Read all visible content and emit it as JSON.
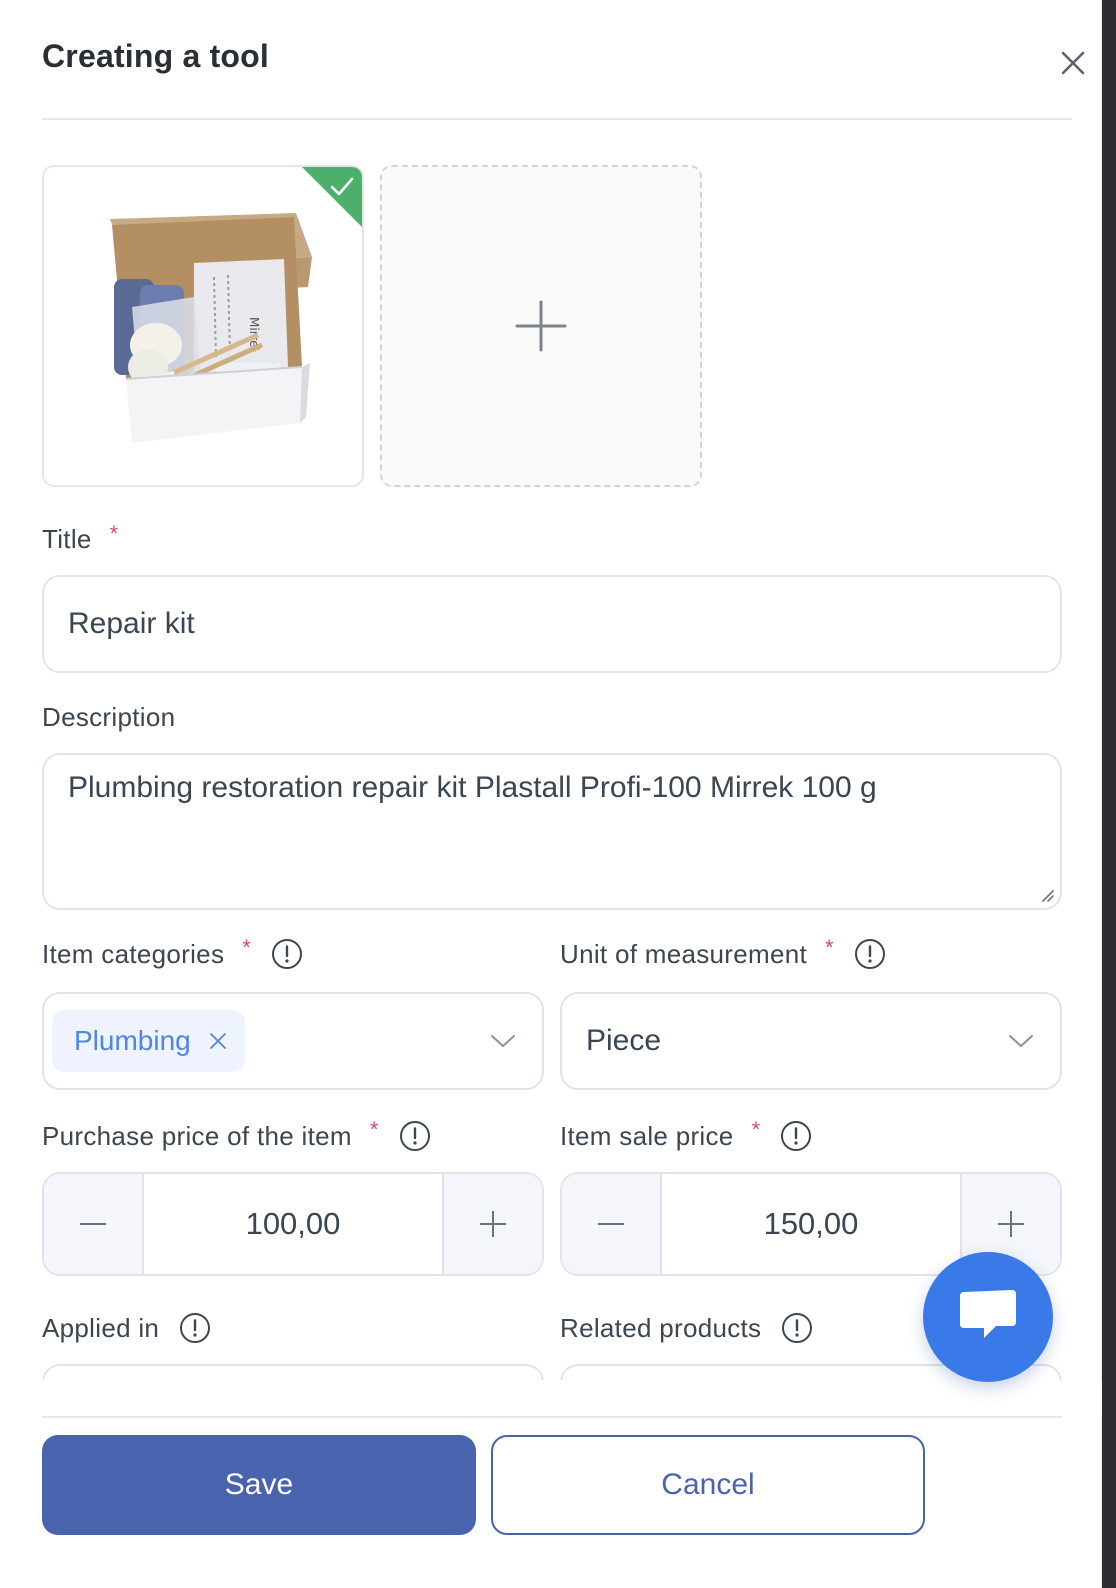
{
  "dialog": {
    "title": "Creating a tool"
  },
  "photos": {
    "add_icon": "plus-icon",
    "selected_icon": "check-icon"
  },
  "title_field": {
    "label": "Title",
    "required_mark": "*",
    "value": "Repair kit"
  },
  "description_field": {
    "label": "Description",
    "value": "Plumbing restoration repair kit Plastall Profi-100 Mirrek 100 g"
  },
  "categories_field": {
    "label": "Item categories",
    "required_mark": "*",
    "selected": [
      "Plumbing"
    ]
  },
  "unit_field": {
    "label": "Unit of measurement",
    "required_mark": "*",
    "value": "Piece"
  },
  "purchase_price": {
    "label": "Purchase price of the item",
    "required_mark": "*",
    "value": "100,00"
  },
  "sale_price": {
    "label": "Item sale price",
    "required_mark": "*",
    "value": "150,00"
  },
  "applied_in": {
    "label": "Applied in"
  },
  "related_products": {
    "label": "Related products"
  },
  "footer": {
    "save_label": "Save",
    "cancel_label": "Cancel"
  },
  "colors": {
    "primary": "#4a63ae",
    "chat_fab": "#3a79e8",
    "required": "#e0457b",
    "chip_bg": "#eef3fd",
    "chip_text": "#4f86e4",
    "check_badge": "#4caf6a"
  }
}
